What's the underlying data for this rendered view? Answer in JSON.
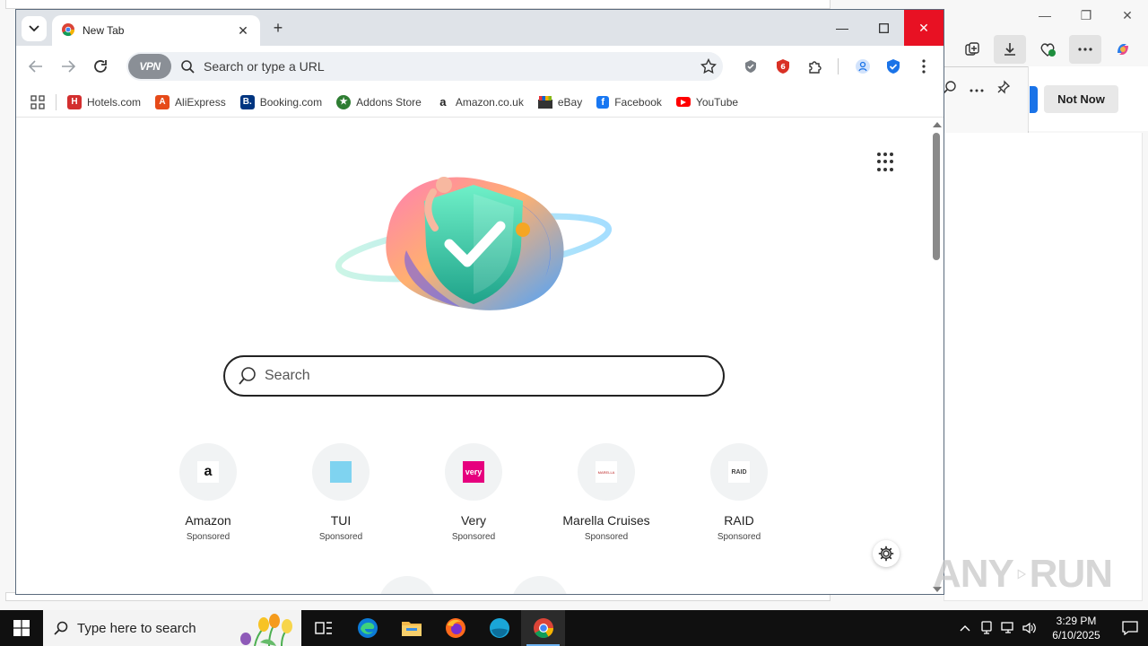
{
  "browser": {
    "tab_title": "New Tab",
    "omnibox_placeholder": "Search or type a URL",
    "vpn_label": "VPN",
    "bookmarks": [
      {
        "label": "Hotels.com",
        "icon": "hotels-icon",
        "color": "#d32f2f"
      },
      {
        "label": "AliExpress",
        "icon": "aliexpress-icon",
        "color": "#e64a19"
      },
      {
        "label": "Booking.com",
        "icon": "booking-icon",
        "color": "#003580"
      },
      {
        "label": "Addons Store",
        "icon": "addons-store-icon",
        "color": "#2e7d32"
      },
      {
        "label": "Amazon.co.uk",
        "icon": "amazon-icon",
        "color": "#222222"
      },
      {
        "label": "eBay",
        "icon": "ebay-icon",
        "color": "#e53238"
      },
      {
        "label": "Facebook",
        "icon": "facebook-icon",
        "color": "#1877f2"
      },
      {
        "label": "YouTube",
        "icon": "youtube-icon",
        "color": "#ff0000"
      }
    ]
  },
  "newtab": {
    "search_placeholder": "Search",
    "tiles": [
      {
        "name": "Amazon",
        "sponsored": "Sponsored",
        "logo": "a"
      },
      {
        "name": "TUI",
        "sponsored": "Sponsored",
        "logo": "tui"
      },
      {
        "name": "Very",
        "sponsored": "Sponsored",
        "logo": "very"
      },
      {
        "name": "Marella Cruises",
        "sponsored": "Sponsored",
        "logo": "MARELLA"
      },
      {
        "name": "RAID",
        "sponsored": "Sponsored",
        "logo": "RAID"
      }
    ]
  },
  "edge_background": {
    "not_now_label": "Not Now"
  },
  "taskbar": {
    "search_placeholder": "Type here to search",
    "time": "3:29 PM",
    "date": "6/10/2025"
  },
  "watermark": {
    "text_left": "ANY",
    "text_right": "RUN"
  },
  "colors": {
    "close_red": "#e81123",
    "accent_blue": "#1a73e8",
    "titlebar": "#dfe3e8"
  }
}
